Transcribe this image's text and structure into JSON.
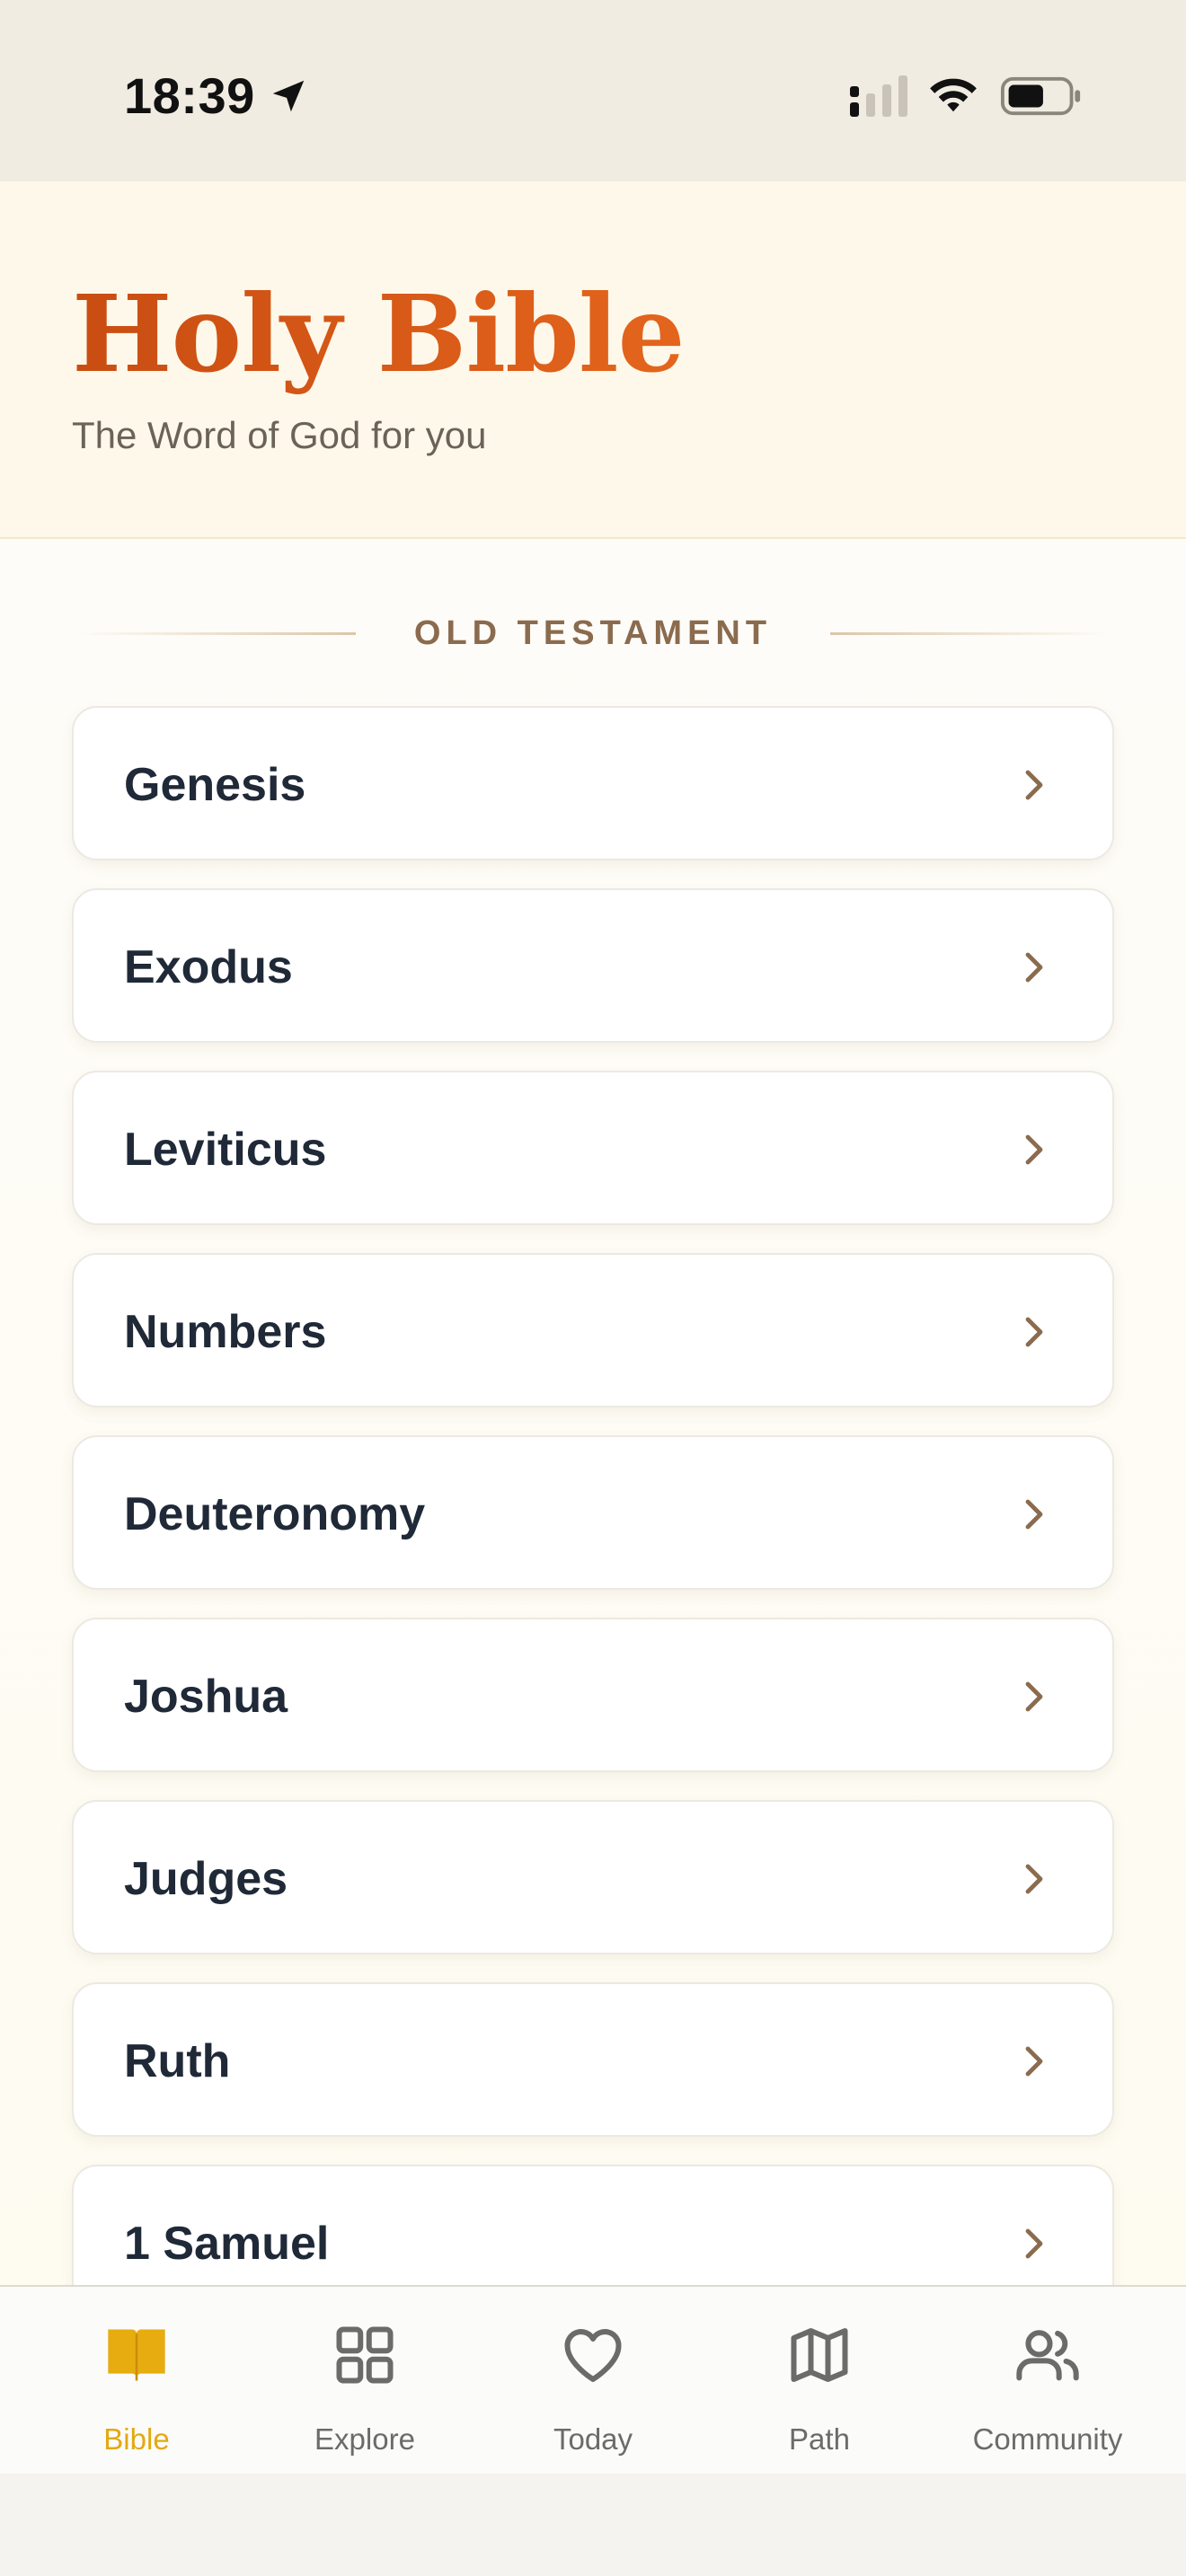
{
  "status_bar": {
    "time": "18:39"
  },
  "header": {
    "title": "Holy Bible",
    "subtitle": "The Word of God for you"
  },
  "section": {
    "label": "OLD TESTAMENT"
  },
  "books": [
    {
      "name": "Genesis"
    },
    {
      "name": "Exodus"
    },
    {
      "name": "Leviticus"
    },
    {
      "name": "Numbers"
    },
    {
      "name": "Deuteronomy"
    },
    {
      "name": "Joshua"
    },
    {
      "name": "Judges"
    },
    {
      "name": "Ruth"
    },
    {
      "name": "1 Samuel"
    }
  ],
  "tabs": [
    {
      "label": "Bible",
      "icon": "book-icon",
      "active": true
    },
    {
      "label": "Explore",
      "icon": "grid-icon",
      "active": false
    },
    {
      "label": "Today",
      "icon": "heart-icon",
      "active": false
    },
    {
      "label": "Path",
      "icon": "map-icon",
      "active": false
    },
    {
      "label": "Community",
      "icon": "users-icon",
      "active": false
    }
  ],
  "colors": {
    "title": "#d45713",
    "active_tab": "#e3a90f",
    "section_label": "#8b6b4e",
    "book_text": "#1f2937"
  }
}
